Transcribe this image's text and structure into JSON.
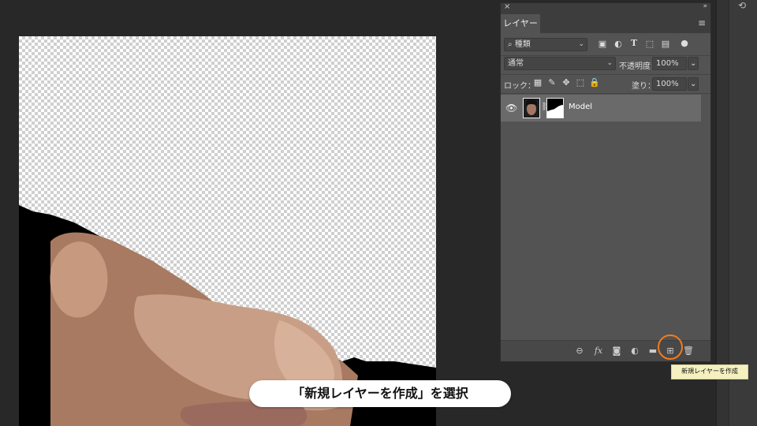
{
  "panel": {
    "close_glyph": "×",
    "collapse_glyph": "»",
    "tab_label": "レイヤー",
    "menu_glyph": "≡",
    "filter": {
      "search_glyph": "⌕",
      "value": "種類",
      "chevron": "⌄"
    },
    "blend_mode": {
      "value": "通常",
      "chevron": "⌄"
    },
    "opacity": {
      "label": "不透明度：",
      "value": "100%",
      "chevron": "⌄"
    },
    "lock": {
      "label": "ロック："
    },
    "fill": {
      "label": "塗り：",
      "value": "100%",
      "chevron": "⌄"
    },
    "filter_icons": [
      "image-filter-icon",
      "adjustment-filter-icon",
      "type-filter-icon",
      "shape-filter-icon",
      "smart-object-filter-icon",
      "filter-toggle-icon"
    ],
    "lock_icons": [
      "lock-transparent-icon",
      "lock-image-icon",
      "lock-position-icon",
      "lock-artboard-icon",
      "lock-all-icon"
    ]
  },
  "layers": [
    {
      "name": "Model",
      "visible": true,
      "has_mask": true
    }
  ],
  "bottom_icons": [
    "link-layers-icon",
    "fx-icon",
    "add-mask-icon",
    "adjustment-layer-icon",
    "new-group-icon",
    "new-layer-icon",
    "delete-layer-icon"
  ],
  "fx_label": "fx",
  "tooltip": "新規レイヤーを作成",
  "caption": "「新規レイヤーを作成」を選択",
  "colors": {
    "highlight_ring": "#f07c1e",
    "panel_bg": "#535353",
    "workspace_bg": "#282828"
  }
}
